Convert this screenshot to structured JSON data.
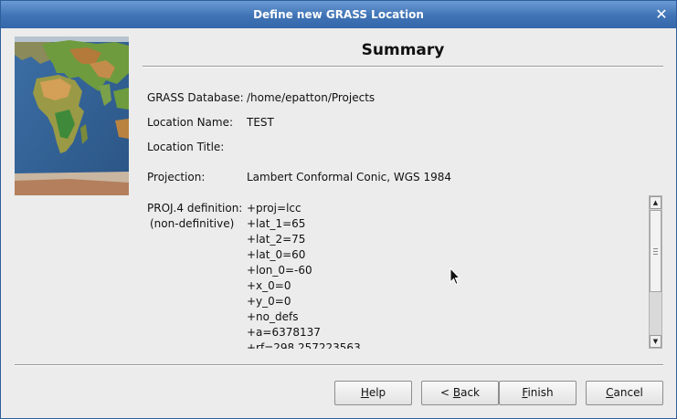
{
  "window": {
    "title": "Define new GRASS Location",
    "close_glyph": "✕"
  },
  "summary": {
    "title": "Summary",
    "fields": [
      {
        "label": "GRASS Database:",
        "value": "/home/epatton/Projects"
      },
      {
        "label": "Location Name:",
        "value": "TEST"
      },
      {
        "label": "Location Title:",
        "value": ""
      },
      {
        "label": "Projection:",
        "value": "Lambert Conformal Conic, WGS 1984"
      }
    ],
    "proj4": {
      "label_line1": "PROJ.4 definition:",
      "label_line2": "(non-definitive)",
      "lines": [
        "+proj=lcc",
        "+lat_1=65",
        "+lat_2=75",
        "+lat_0=60",
        "+lon_0=-60",
        "+x_0=0",
        "+y_0=0",
        "+no_defs",
        "+a=6378137",
        "+rf=298.257223563"
      ]
    }
  },
  "buttons": {
    "help": {
      "mnemonic": "H",
      "rest": "elp"
    },
    "back": {
      "prefix": "< ",
      "mnemonic": "B",
      "rest": "ack"
    },
    "finish": {
      "mnemonic": "F",
      "rest": "inish"
    },
    "cancel": {
      "mnemonic": "C",
      "rest": "ancel"
    }
  },
  "icons": {
    "close": "close-icon",
    "scroll_up": "scroll-up-arrow-icon",
    "scroll_down": "scroll-down-arrow-icon",
    "cursor": "mouse-pointer-icon"
  },
  "colors": {
    "titlebar": "#3f73b5",
    "background": "#ececec"
  }
}
